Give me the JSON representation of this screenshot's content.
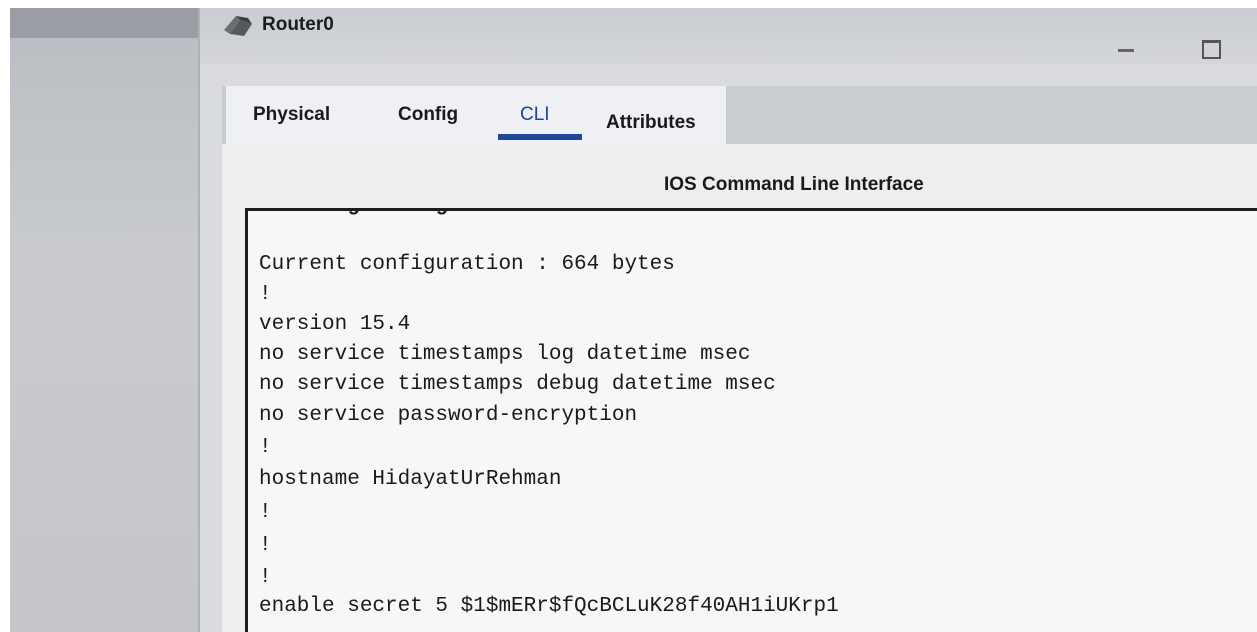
{
  "corner_text": "",
  "window": {
    "title": "Router0",
    "icon": "router-icon",
    "controls": {
      "minimize": "minimize-icon",
      "maximize": "maximize-icon"
    }
  },
  "tabs": [
    {
      "label": "Physical",
      "active": false
    },
    {
      "label": "Config",
      "active": false
    },
    {
      "label": "CLI",
      "active": true
    },
    {
      "label": "Attributes",
      "active": false
    }
  ],
  "panel": {
    "title": "IOS Command Line Interface"
  },
  "terminal": {
    "cut_line": "Building configuration...",
    "lines": [
      "",
      "Current configuration : 664 bytes",
      "!",
      "version 15.4",
      "no service timestamps log datetime msec",
      "no service timestamps debug datetime msec",
      "no service password-encryption",
      "!",
      "hostname HidayatUrRehman",
      "!",
      "!",
      "!",
      "enable secret 5 $1$mERr$fQcBCLuK28f40AH1iUKrp1"
    ]
  },
  "colors": {
    "active_tab_text": "#1f43a8",
    "active_tab_underline": "#21479a",
    "terminal_bg": "#f7f7f6",
    "terminal_text": "#1a1a1a"
  }
}
